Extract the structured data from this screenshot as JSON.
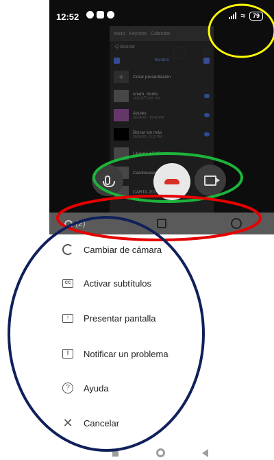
{
  "status": {
    "time": "12:52",
    "battery": "79"
  },
  "drive": {
    "tabs": [
      "Inicio",
      "Keynote",
      "Calendar"
    ],
    "search_placeholder": "Q Buscar",
    "sort_label": "Nombre",
    "items": [
      {
        "name": "Crear presentación",
        "date": "",
        "thumb": "new"
      },
      {
        "name": "unam_fronts",
        "date": "1/05/20 - 4:55 PM",
        "thumb": "grey"
      },
      {
        "name": "Azules",
        "date": "30/04/20 - 10:45 PM",
        "thumb": "blue"
      },
      {
        "name": "Borrar sin más",
        "date": "28/04/20 - 3:11 PM",
        "thumb": "dark"
      },
      {
        "name": "Librería 15.27",
        "date": "",
        "thumb": "grey"
      },
      {
        "name": "Cardiovascular 2010.03",
        "date": "",
        "thumb": "grey"
      },
      {
        "name": "CARTA 2019",
        "date": "",
        "thumb": "grey"
      }
    ]
  },
  "call_tabs": {
    "people_count": "(2)"
  },
  "menu": [
    {
      "label": "Cambiar de cámara",
      "icon": "switch-camera-icon"
    },
    {
      "label": "Activar subtítulos",
      "icon": "captions-icon"
    },
    {
      "label": "Presentar pantalla",
      "icon": "present-screen-icon"
    },
    {
      "label": "Notificar un problema",
      "icon": "feedback-icon"
    },
    {
      "label": "Ayuda",
      "icon": "help-icon"
    },
    {
      "label": "Cancelar",
      "icon": "close-icon"
    }
  ],
  "annotation_colors": {
    "yellow": "#ffff00",
    "green": "#1db33b",
    "red": "#e60000",
    "navy": "#10205a"
  }
}
